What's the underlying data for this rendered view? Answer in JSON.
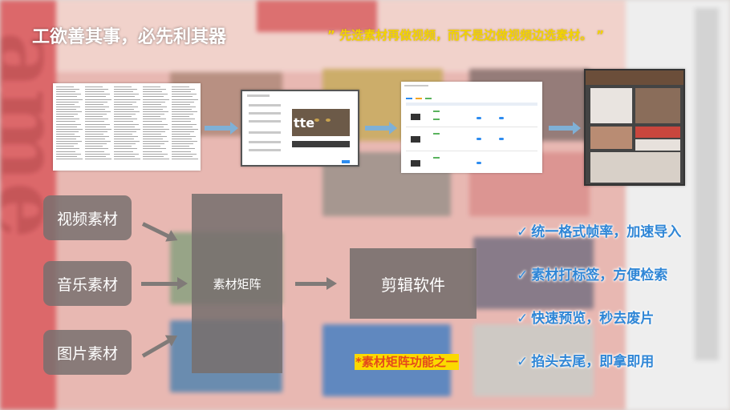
{
  "slide": {
    "title": "工欲善其事，必先利其器",
    "quote": "” 先选素材再做视频，而不是边做视频边选素材。 ”"
  },
  "workflow": {
    "dialog_text": "tte"
  },
  "sources": [
    {
      "label": "视频素材"
    },
    {
      "label": "音乐素材"
    },
    {
      "label": "图片素材"
    }
  ],
  "matrix": {
    "label": "素材矩阵"
  },
  "editor": {
    "label": "剪辑软件"
  },
  "features": [
    {
      "check": "✓",
      "text": "统一格式帧率，加速导入"
    },
    {
      "check": "✓",
      "text": "素材打标签，方便检索"
    },
    {
      "check": "✓",
      "text": "快速预览，秒去废片"
    },
    {
      "check": "✓",
      "text": "掐头去尾，即拿即用"
    }
  ],
  "note": "*素材矩阵功能之一",
  "colors": {
    "title": "#ffffff",
    "quote": "#f2d400",
    "feature": "#2f86d6",
    "note_text": "#e44a1b",
    "note_bg": "#fbd900",
    "box": "#78706e",
    "flow_arrow": "#7fb0d6"
  }
}
